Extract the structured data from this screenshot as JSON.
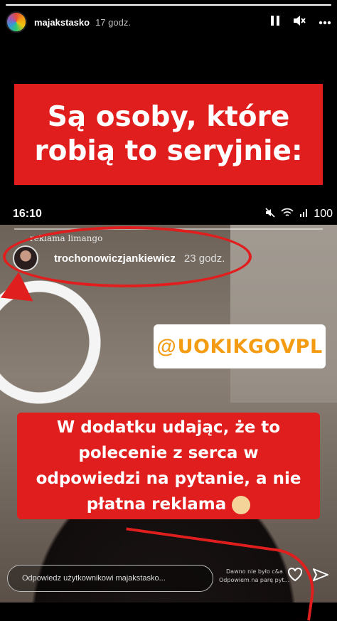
{
  "story": {
    "progress": 1.0,
    "username": "majakstasko",
    "time": "17 godz.",
    "icons": [
      "pause-icon",
      "mute-icon",
      "more-icon"
    ]
  },
  "title": "Są osoby, które\nrobią to seryjnie:",
  "phone_status": {
    "clock": "16:10",
    "battery": "100"
  },
  "embedded": {
    "sponsored": "reklama limango",
    "username": "trochonowiczjankiewicz",
    "time": "23 godz."
  },
  "tag": {
    "text": "UOKIKGOVPL"
  },
  "caption": "W dodatku udając, że to\npolecenie z serca w\nodpowiedzi na pytanie, a nie\npłatna reklama",
  "reply": {
    "placeholder": "Odpowiedz użytkownikowi majakstasko...",
    "strip_line1": "Dawno nie było c&a",
    "strip_line2": "Odpowiem na parę pyt..."
  },
  "colors": {
    "accent_red": "#e01e1e",
    "tag_orange": "#f39c12"
  }
}
